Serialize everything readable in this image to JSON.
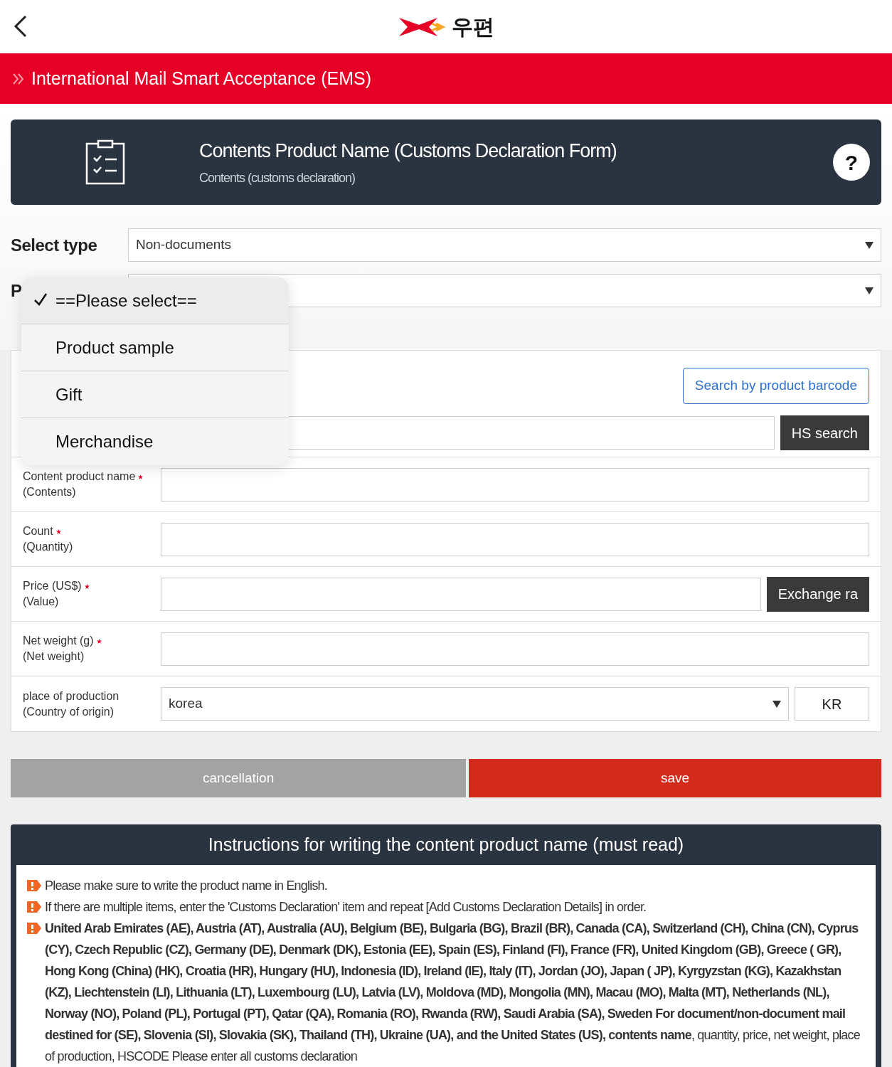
{
  "top_bar": {
    "logo_text": "우편"
  },
  "banner": {
    "title": "International Mail Smart Acceptance (EMS)"
  },
  "header_card": {
    "title": "Contents Product Name (Customs Declaration Form)",
    "subtitle": "Contents (customs declaration)",
    "help": "?"
  },
  "type_field": {
    "label": "Select type",
    "value": "Non-documents"
  },
  "product_type_field": {
    "label": "P"
  },
  "popup_menu": {
    "options": [
      {
        "label": "==Please select==",
        "selected": true
      },
      {
        "label": "Product sample",
        "selected": false
      },
      {
        "label": "Gift",
        "selected": false
      },
      {
        "label": "Merchandise",
        "selected": false
      }
    ]
  },
  "barcode_button": "Search by product barcode",
  "hs_search_button": "HS search",
  "fields": [
    {
      "kind": "input",
      "label": "Content product name",
      "required": true,
      "sublabel": "(Contents)"
    },
    {
      "kind": "input",
      "label": "Count",
      "required": true,
      "sublabel": "(Quantity)"
    },
    {
      "kind": "input_button",
      "label": "Price (US$)",
      "required": true,
      "sublabel": "(Value)",
      "button": "Exchange ra"
    },
    {
      "kind": "input",
      "label": "Net weight (g)",
      "required": true,
      "sublabel": "(Net weight)"
    },
    {
      "kind": "select_code",
      "label": "place of production",
      "required": false,
      "sublabel": "(Country of origin)",
      "value": "korea",
      "code": "KR"
    }
  ],
  "actions": [
    {
      "kind": "cancel",
      "label": "cancellation"
    },
    {
      "kind": "save",
      "label": "save"
    }
  ],
  "instructions": {
    "title": "Instructions for writing the content product name (must read)",
    "items": [
      "Please make sure to write the product name in English.",
      "If there are multiple items, enter the 'Customs Declaration' item and repeat [Add Customs Declaration Details] in order.",
      "**United Arab Emirates (AE), Austria (AT), Australia (AU), Belgium (BE), Bulgaria (BG), Brazil (BR), Canada (CA), Switzerland (CH), China (CN), Cyprus (CY), Czech Republic (CZ), Germany (DE), Denmark (DK), Estonia (EE), Spain (ES), Finland (FI), France (FR), United Kingdom (GB), Greece ( GR), Hong Kong (China) (HK), Croatia (HR), Hungary (HU), Indonesia (ID), Ireland (IE), Italy (IT), Jordan (JO), Japan ( JP), Kyrgyzstan (KG), Kazakhstan (KZ), Liechtenstein (LI), Lithuania (LT), Luxembourg (LU), Latvia (LV), Moldova (MD), Mongolia (MN), Macau (MO), Malta (MT), Netherlands (NL), Norway (NO), Poland (PL), Portugal (PT), Qatar (QA), Romania (RO), Rwanda (RW), Saudi Arabia (SA), Sweden For document/non-document mail destined for (SE), Slovenia (SI), Slovakia (SK), Thailand (TH), Ukraine (UA), and the United States (US), contents name**, quantity, price, net weight, place of production, HSCODE Please enter all customs declaration"
    ]
  }
}
